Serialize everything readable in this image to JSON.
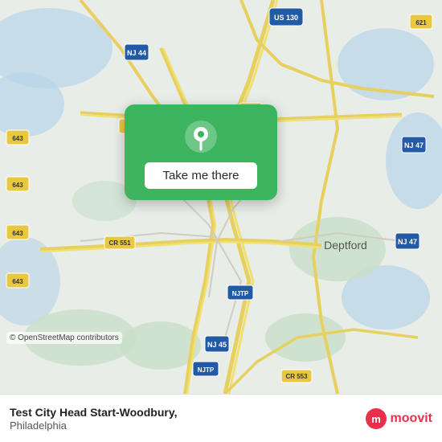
{
  "map": {
    "osm_credit": "© OpenStreetMap contributors"
  },
  "card": {
    "button_label": "Take me there"
  },
  "bottom_bar": {
    "place_name": "Test City Head Start-Woodbury,",
    "place_city": "Philadelphia",
    "moovit_label": "moovit"
  },
  "colors": {
    "card_green": "#3cb55e",
    "moovit_red": "#e8304a"
  }
}
